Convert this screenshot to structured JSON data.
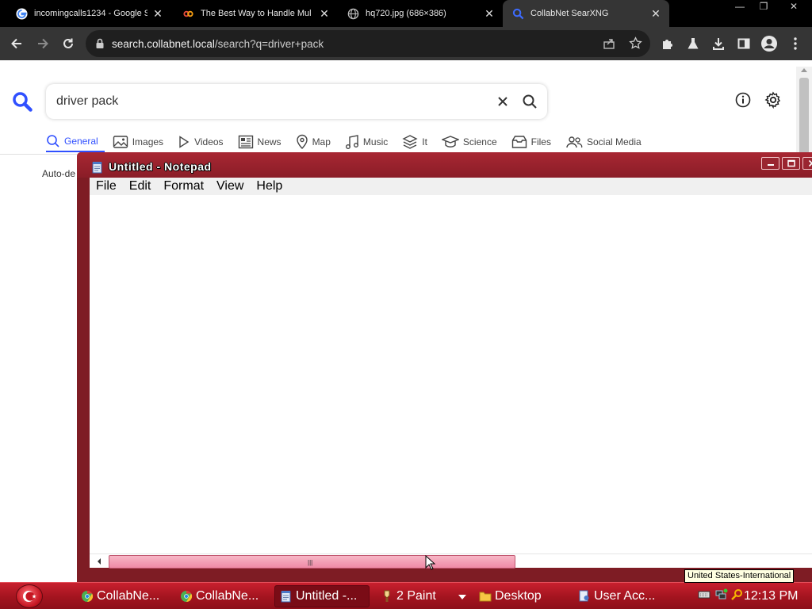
{
  "browser": {
    "tabs": [
      {
        "title": "incomingcalls1234 - Google Sl",
        "favicon": "google-icon"
      },
      {
        "title": "The Best Way to Handle Mul",
        "favicon": "link-icon"
      },
      {
        "title": "hq720.jpg (686×386)",
        "favicon": "globe-icon"
      },
      {
        "title": "CollabNet SearXNG",
        "favicon": "search-icon",
        "active": true
      }
    ],
    "address": {
      "host": "search.collabnet.local",
      "path": "/search?q=driver+pack"
    },
    "colors": {
      "frame": "#000000",
      "toolbar": "#353535",
      "omnibox": "#1f1f1f"
    }
  },
  "searx": {
    "query": "driver pack",
    "accent": "#3050ff",
    "categories": [
      {
        "label": "General",
        "icon": "search-icon",
        "active": true
      },
      {
        "label": "Images",
        "icon": "image-icon"
      },
      {
        "label": "Videos",
        "icon": "play-icon"
      },
      {
        "label": "News",
        "icon": "newspaper-icon"
      },
      {
        "label": "Map",
        "icon": "map-pin-icon"
      },
      {
        "label": "Music",
        "icon": "music-icon"
      },
      {
        "label": "It",
        "icon": "layers-icon"
      },
      {
        "label": "Science",
        "icon": "school-icon"
      },
      {
        "label": "Files",
        "icon": "archive-icon"
      },
      {
        "label": "Social Media",
        "icon": "people-icon"
      }
    ],
    "autodetect_text": "Auto-de"
  },
  "notepad": {
    "title": "Untitled - Notepad",
    "menus": [
      "File",
      "Edit",
      "Format",
      "View",
      "Help"
    ],
    "content": "",
    "frame_color": "#8a1d27"
  },
  "taskbar": {
    "color": "#a3141f",
    "items": [
      {
        "label": "CollabNe...",
        "icon": "chrome-icon"
      },
      {
        "label": "CollabNe...",
        "icon": "chrome-icon"
      },
      {
        "label": "Untitled -...",
        "icon": "notepad-icon",
        "active": true
      },
      {
        "label": "2 Paint",
        "icon": "paint-icon"
      },
      {
        "label": "Desktop",
        "icon": "folder-icon"
      },
      {
        "label": "User Acc...",
        "icon": "user-accounts-icon"
      }
    ],
    "clock": "12:13 PM",
    "tooltip": "United States-International"
  }
}
